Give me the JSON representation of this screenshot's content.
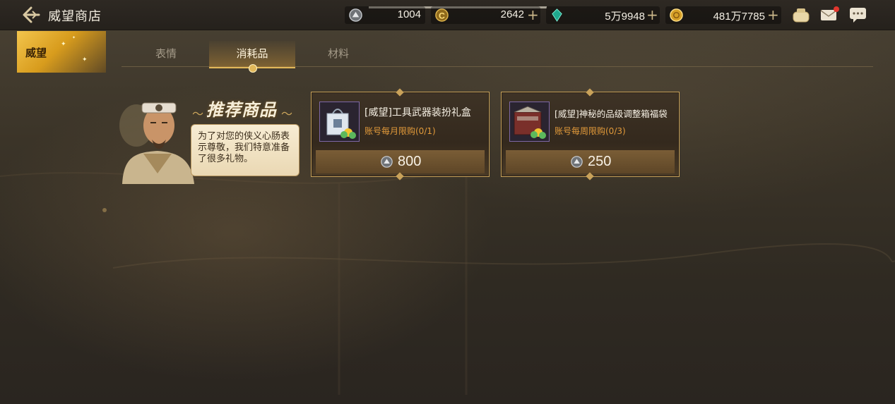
{
  "header": {
    "title": "威望商店",
    "resources": [
      {
        "icon": "prestige-coin-icon",
        "value": "1004",
        "has_plus": false
      },
      {
        "icon": "gold-c-coin-icon",
        "value": "2642",
        "has_plus": true
      },
      {
        "icon": "green-gem-icon",
        "value": "5万9948",
        "has_plus": true
      },
      {
        "icon": "gold-coin-icon",
        "value": "481万7785",
        "has_plus": true
      }
    ],
    "top_icons": [
      "treasure-bag-icon",
      "mail-icon",
      "chat-icon"
    ]
  },
  "category": {
    "label": "威望"
  },
  "subtabs": [
    {
      "label": "表情",
      "active": false
    },
    {
      "label": "消耗品",
      "active": true
    },
    {
      "label": "材料",
      "active": false
    }
  ],
  "recommend": {
    "title": "推荐商品",
    "speech": "为了对您的侠义心肠表示尊敬，我们特意准备了很多礼物。"
  },
  "products": [
    {
      "name": "[威望]工具武器装扮礼盒",
      "limit": "账号每月限购(0/1)",
      "price": "800",
      "thumb": "gift-bag-icon"
    },
    {
      "name": "[威望]神秘的品级调整箱福袋",
      "limit": "账号每周限购(0/3)",
      "price": "250",
      "thumb": "mystery-box-icon"
    }
  ],
  "colors": {
    "accent": "#c9a25a",
    "limit_text": "#e29a3a",
    "tab_active": "#e2b85a"
  }
}
